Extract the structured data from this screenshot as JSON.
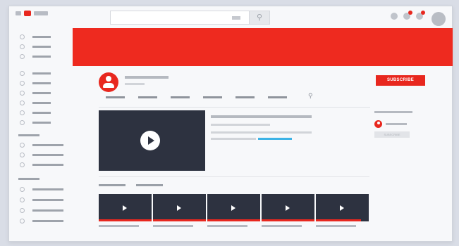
{
  "header": {
    "search_icon": "magnifier-icon",
    "search_glyph": "⚲"
  },
  "channel": {
    "subscribe_label": "SUBSCRIBE",
    "side_subscribe_label": "SUBSCRIBE",
    "tab_search_glyph": "⚲"
  },
  "colors": {
    "brand_red": "#e8271e",
    "video_dark": "#2d3240",
    "progress_blue": "#3db3e6"
  },
  "thumbnails_count_shown": 5
}
